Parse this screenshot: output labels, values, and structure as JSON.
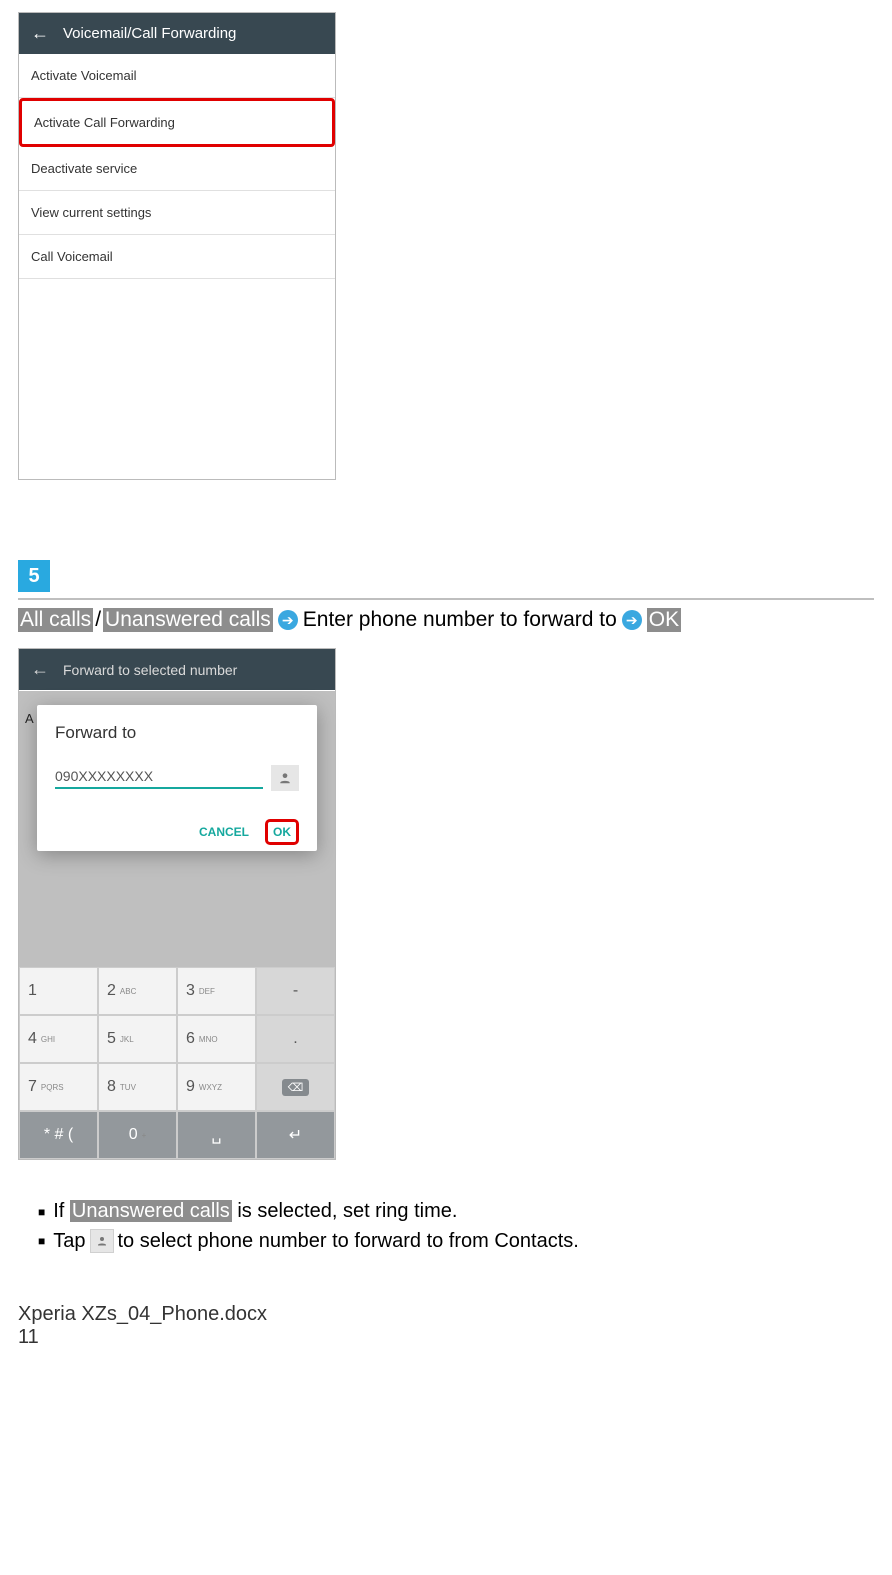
{
  "screenshot1": {
    "title": "Voicemail/Call Forwarding",
    "items": [
      "Activate Voicemail",
      "Activate Call Forwarding",
      "Deactivate service",
      "View current settings",
      "Call Voicemail"
    ],
    "highlight_index": 1
  },
  "step_number": "5",
  "instruction": {
    "opt1": "All calls",
    "slash": "/",
    "opt2": "Unanswered calls",
    "middle_text": " Enter phone number to forward to ",
    "ok": "OK"
  },
  "screenshot2": {
    "header": "Forward to selected number",
    "side": "A",
    "dialog_title": "Forward to",
    "input_value": "090XXXXXXXX",
    "cancel": "CANCEL",
    "ok": "OK",
    "keypad": [
      {
        "main": "1",
        "sub": ""
      },
      {
        "main": "2",
        "sub": "ABC"
      },
      {
        "main": "3",
        "sub": "DEF"
      },
      {
        "main": "-",
        "sub": ""
      },
      {
        "main": "4",
        "sub": "GHI"
      },
      {
        "main": "5",
        "sub": "JKL"
      },
      {
        "main": "6",
        "sub": "MNO"
      },
      {
        "main": ".",
        "sub": ""
      },
      {
        "main": "7",
        "sub": "PQRS"
      },
      {
        "main": "8",
        "sub": "TUV"
      },
      {
        "main": "9",
        "sub": "WXYZ"
      },
      {
        "main": "⌫",
        "sub": "",
        "bs": true
      },
      {
        "main": "* # (",
        "sub": ""
      },
      {
        "main": "0",
        "sub": "+"
      },
      {
        "main": "␣",
        "sub": ""
      },
      {
        "main": "↵",
        "sub": ""
      }
    ]
  },
  "bullets": {
    "b1_prefix": "If ",
    "b1_hl": "Unanswered calls",
    "b1_suffix": " is selected, set ring time.",
    "b2_prefix": "Tap ",
    "b2_suffix": " to select phone number to forward to from Contacts."
  },
  "footer": {
    "filename": "Xperia XZs_04_Phone.docx",
    "page": "11"
  }
}
